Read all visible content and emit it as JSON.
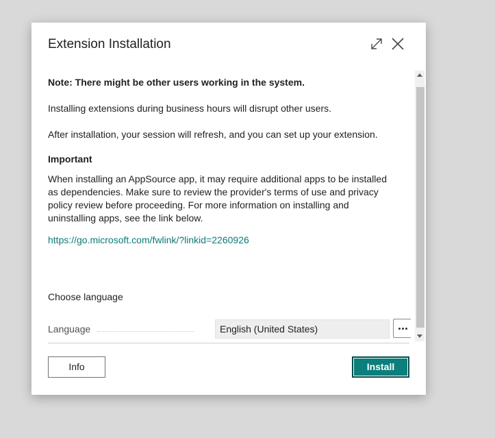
{
  "dialog": {
    "title": "Extension Installation",
    "icons": {
      "expand": "expand-icon",
      "close": "close-icon"
    }
  },
  "content": {
    "note": "Note: There might be other users working in the system.",
    "p2": "Installing extensions during business hours will disrupt other users.",
    "p3": "After installation, your session will refresh, and you can set up your extension.",
    "important_heading": "Important",
    "body_lines": [
      "When installing an AppSource app, it may require additional apps to be installed",
      "as dependencies. Make sure to review the provider's terms of use and privacy",
      "policy review before proceeding. For more information on installing and",
      "uninstalling apps, see the link below."
    ],
    "link": "https://go.microsoft.com/fwlink/?linkid=2260926",
    "choose_language": "Choose language",
    "language_label": "Language",
    "language_value": "English (United States)"
  },
  "buttons": {
    "info": "Info",
    "install": "Install"
  },
  "colors": {
    "accent": "#0a7f7c",
    "link": "#0b7a75",
    "background": "#d9d9d9"
  }
}
